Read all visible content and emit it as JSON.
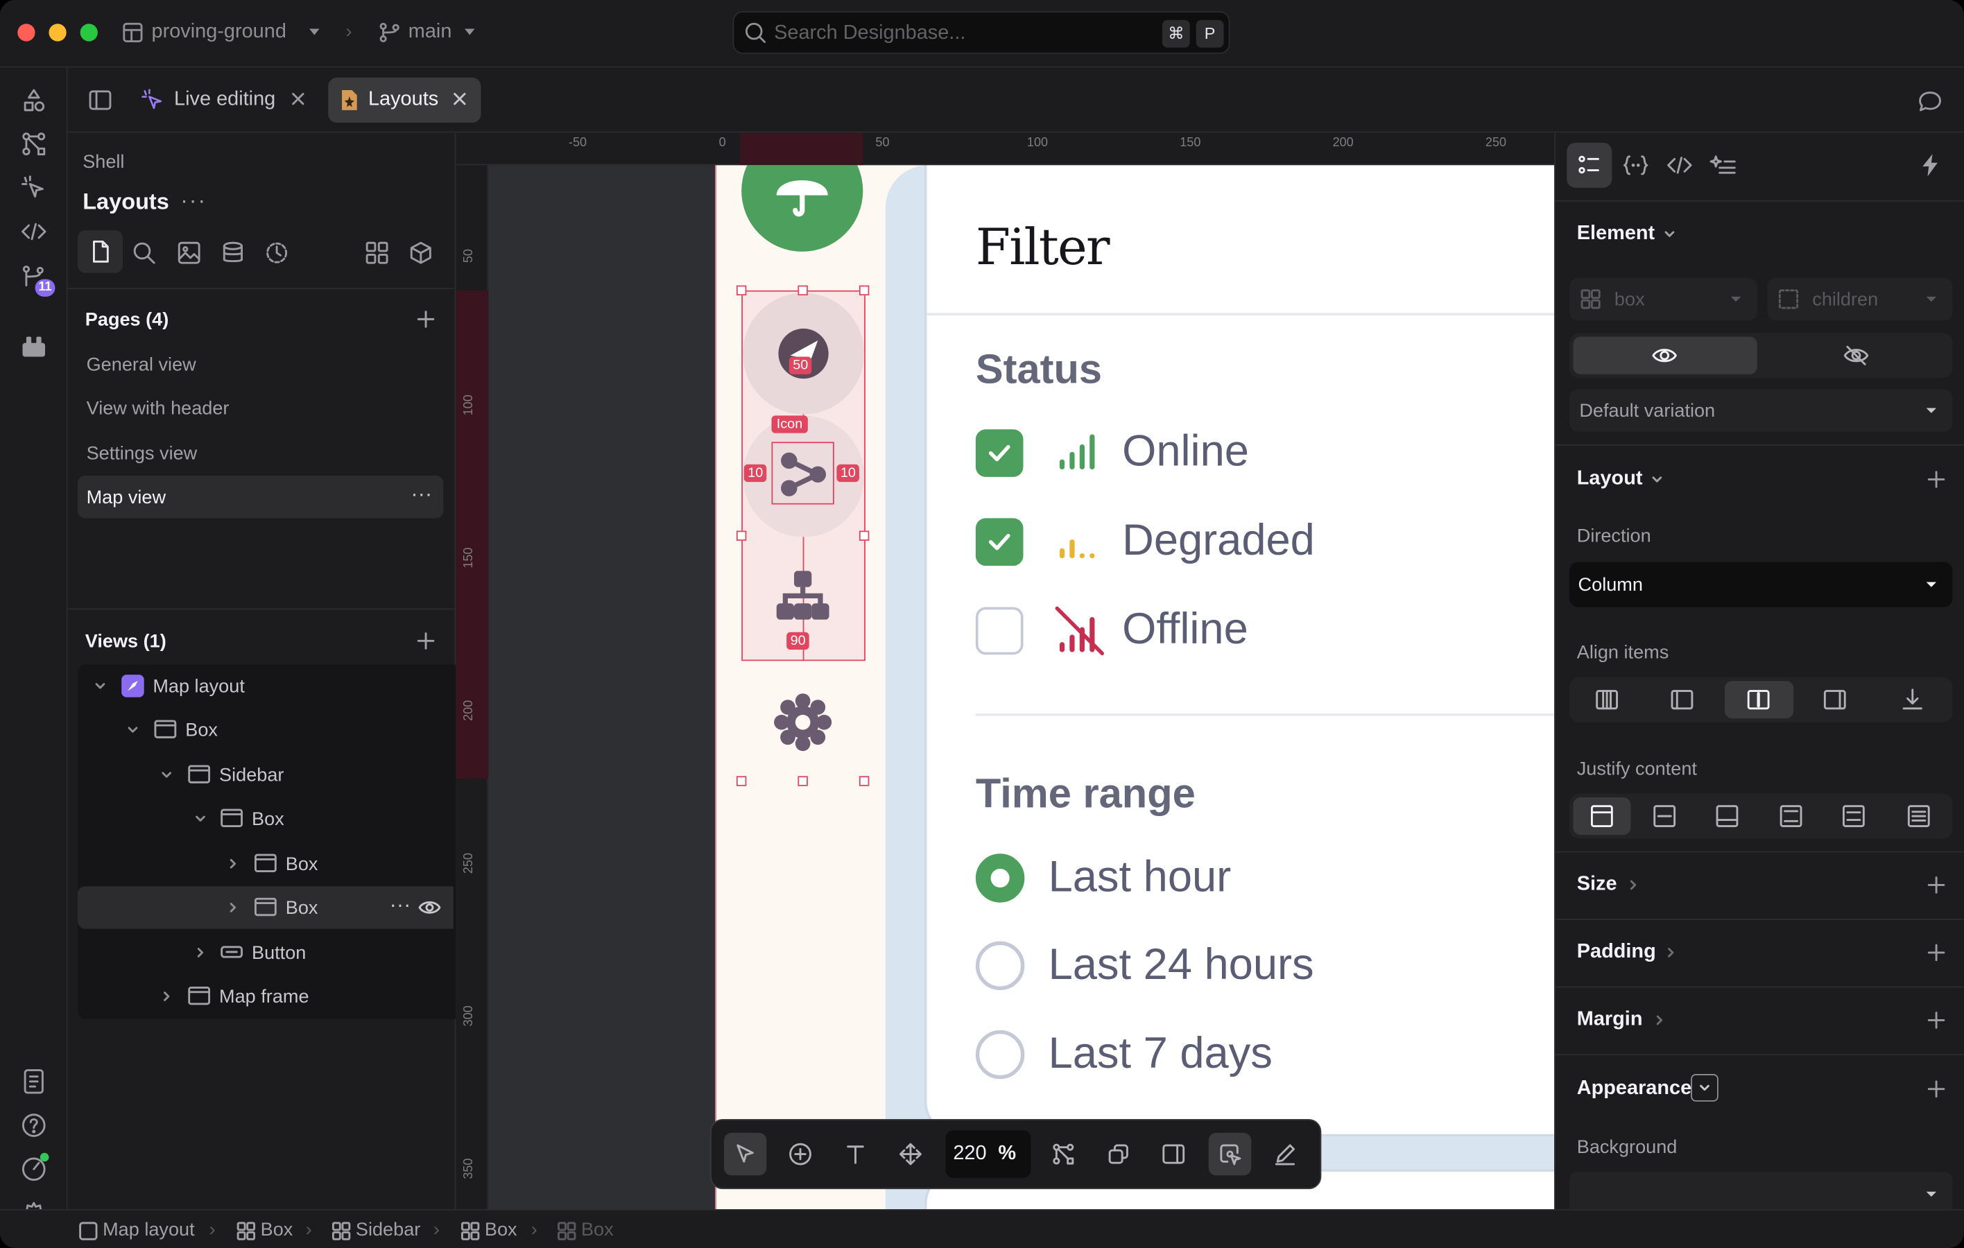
{
  "window": {
    "project": "proving-ground",
    "branch": "main",
    "search_placeholder": "Search Designbase...",
    "shortcut_mod": "⌘",
    "shortcut_key": "P"
  },
  "rail": {
    "badge": "11"
  },
  "tabs": [
    {
      "label": "Live editing",
      "active": false
    },
    {
      "label": "Layouts",
      "active": true
    }
  ],
  "left_panel": {
    "breadcrumb": "Shell",
    "title": "Layouts",
    "pages_header": "Pages (4)",
    "pages": [
      {
        "label": "General view",
        "selected": false
      },
      {
        "label": "View with header",
        "selected": false
      },
      {
        "label": "Settings view",
        "selected": false
      },
      {
        "label": "Map view",
        "selected": true
      }
    ],
    "views_header": "Views (1)",
    "tree": [
      {
        "label": "Map layout",
        "depth": 0,
        "expanded": true
      },
      {
        "label": "Box",
        "depth": 1,
        "expanded": true
      },
      {
        "label": "Sidebar",
        "depth": 2,
        "expanded": true
      },
      {
        "label": "Box",
        "depth": 3,
        "expanded": true
      },
      {
        "label": "Box",
        "depth": 4,
        "expanded": false
      },
      {
        "label": "Box",
        "depth": 4,
        "expanded": false,
        "selected": true
      },
      {
        "label": "Button",
        "depth": 3,
        "expanded": false
      },
      {
        "label": "Map frame",
        "depth": 2,
        "expanded": false
      }
    ]
  },
  "canvas": {
    "ruler_top": [
      "-50",
      "0",
      "50",
      "100",
      "150",
      "200",
      "250"
    ],
    "ruler_left": [
      "50",
      "100",
      "150",
      "200",
      "250",
      "300",
      "350"
    ],
    "badges": {
      "top": "50",
      "element": "Icon",
      "left": "10",
      "right": "10",
      "bottom": "90"
    },
    "filter": {
      "title": "Filter",
      "status_header": "Status",
      "status_options": [
        {
          "label": "Online",
          "checked": true
        },
        {
          "label": "Degraded",
          "checked": true
        },
        {
          "label": "Offline",
          "checked": false
        }
      ],
      "time_header": "Time range",
      "time_options": [
        {
          "label": "Last hour",
          "selected": true
        },
        {
          "label": "Last 24 hours",
          "selected": false
        },
        {
          "label": "Last 7 days",
          "selected": false
        }
      ]
    },
    "colors": {
      "green": "#4c9f5c",
      "amber": "#e8b431",
      "red": "#c62f4f",
      "selection": "#e0465f"
    }
  },
  "toolbar": {
    "zoom": "220",
    "zoom_unit": "%"
  },
  "right_panel": {
    "element_header": "Element",
    "element_type": "box",
    "children_label": "children",
    "variation": "Default variation",
    "layout_header": "Layout",
    "direction_label": "Direction",
    "direction_value": "Column",
    "align_label": "Align items",
    "justify_label": "Justify content",
    "size_header": "Size",
    "padding_header": "Padding",
    "margin_header": "Margin",
    "appearance_header": "Appearance",
    "background_label": "Background"
  },
  "status_bar": {
    "crumbs": [
      "Map layout",
      "Box",
      "Sidebar",
      "Box",
      "Box"
    ]
  }
}
